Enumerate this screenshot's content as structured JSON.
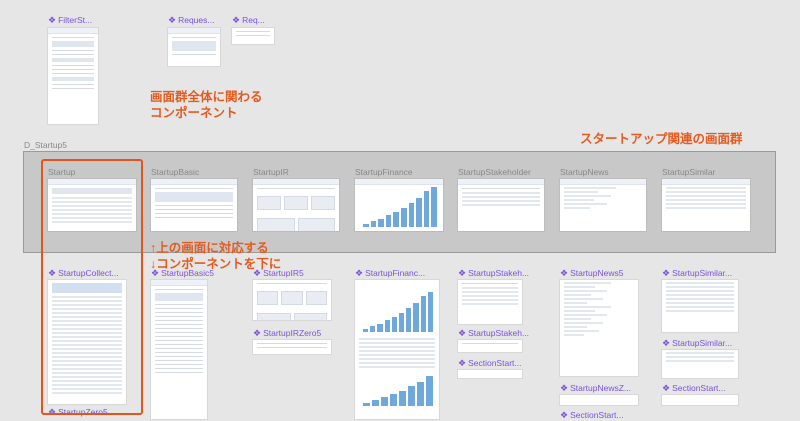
{
  "top_components": {
    "items": [
      {
        "label": "FilterSt..."
      },
      {
        "label": "Reques..."
      },
      {
        "label": "Req..."
      }
    ],
    "annotation_line1": "画面群全体に関わる",
    "annotation_line2": "コンポーネント"
  },
  "section": {
    "title": "D_Startup5",
    "annotation": "スタートアップ関連の画面群",
    "frames": [
      {
        "label": "Startup"
      },
      {
        "label": "StartupBasic"
      },
      {
        "label": "StartupIR"
      },
      {
        "label": "StartupFinance"
      },
      {
        "label": "StartupStakeholder"
      },
      {
        "label": "StartupNews"
      },
      {
        "label": "StartupSimilar"
      }
    ]
  },
  "middle_annotation": {
    "line1": "↑上の画面に対応する",
    "line2": "↓コンポーネントを下に"
  },
  "components": {
    "col1": [
      "StartupCollect...",
      "StartupZero5"
    ],
    "col2": [
      "StartupBasic5"
    ],
    "col3": [
      "StartupIR5",
      "StartupIRZero5"
    ],
    "col4": [
      "StartupFinanc..."
    ],
    "col5": [
      "StartupStakeh...",
      "StartupStakeh...",
      "SectionStart..."
    ],
    "col6": [
      "StartupNews5",
      "StartupNewsZ...",
      "SectionStart..."
    ],
    "col7": [
      "StartupSimilar...",
      "StartupSimilar...",
      "SectionStart..."
    ]
  },
  "colors": {
    "accent": "#7b52d9",
    "annotation": "#e45a1f",
    "highlight_border": "#e0561c"
  },
  "icon": "component-diamond-icon"
}
